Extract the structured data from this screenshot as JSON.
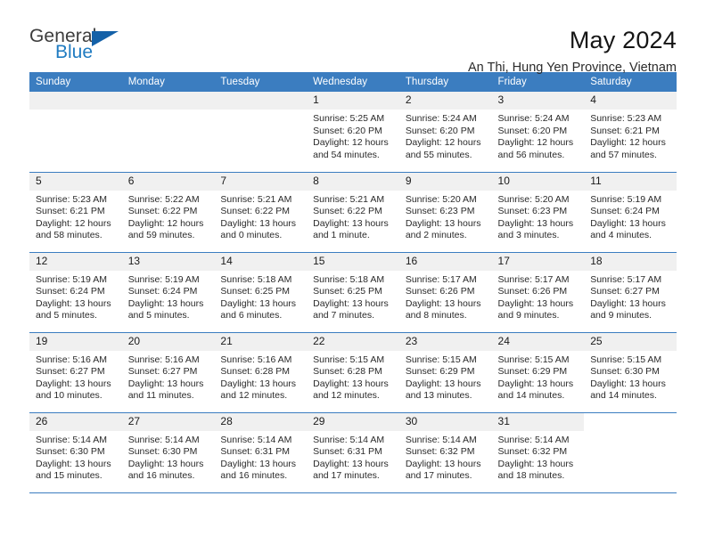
{
  "logo": {
    "word1": "General",
    "word2": "Blue",
    "accent_color": "#1461a8"
  },
  "header": {
    "title": "May 2024",
    "subtitle": "An Thi, Hung Yen Province, Vietnam"
  },
  "theme": {
    "header_bg": "#3b7dc0",
    "daynum_bg": "#f0f0f0",
    "text": "#2a2a2a"
  },
  "labels": {
    "sunrise": "Sunrise:",
    "sunset": "Sunset:",
    "daylight": "Daylight:"
  },
  "weekdays": [
    "Sunday",
    "Monday",
    "Tuesday",
    "Wednesday",
    "Thursday",
    "Friday",
    "Saturday"
  ],
  "weeks": [
    [
      {
        "day": "",
        "empty": true,
        "strip": true
      },
      {
        "day": "",
        "empty": true,
        "strip": true
      },
      {
        "day": "",
        "empty": true,
        "strip": true
      },
      {
        "day": "1",
        "sunrise": "Sunrise: 5:25 AM",
        "sunset": "Sunset: 6:20 PM",
        "daylight": "Daylight: 12 hours and 54 minutes."
      },
      {
        "day": "2",
        "sunrise": "Sunrise: 5:24 AM",
        "sunset": "Sunset: 6:20 PM",
        "daylight": "Daylight: 12 hours and 55 minutes."
      },
      {
        "day": "3",
        "sunrise": "Sunrise: 5:24 AM",
        "sunset": "Sunset: 6:20 PM",
        "daylight": "Daylight: 12 hours and 56 minutes."
      },
      {
        "day": "4",
        "sunrise": "Sunrise: 5:23 AM",
        "sunset": "Sunset: 6:21 PM",
        "daylight": "Daylight: 12 hours and 57 minutes."
      }
    ],
    [
      {
        "day": "5",
        "sunrise": "Sunrise: 5:23 AM",
        "sunset": "Sunset: 6:21 PM",
        "daylight": "Daylight: 12 hours and 58 minutes."
      },
      {
        "day": "6",
        "sunrise": "Sunrise: 5:22 AM",
        "sunset": "Sunset: 6:22 PM",
        "daylight": "Daylight: 12 hours and 59 minutes."
      },
      {
        "day": "7",
        "sunrise": "Sunrise: 5:21 AM",
        "sunset": "Sunset: 6:22 PM",
        "daylight": "Daylight: 13 hours and 0 minutes."
      },
      {
        "day": "8",
        "sunrise": "Sunrise: 5:21 AM",
        "sunset": "Sunset: 6:22 PM",
        "daylight": "Daylight: 13 hours and 1 minute."
      },
      {
        "day": "9",
        "sunrise": "Sunrise: 5:20 AM",
        "sunset": "Sunset: 6:23 PM",
        "daylight": "Daylight: 13 hours and 2 minutes."
      },
      {
        "day": "10",
        "sunrise": "Sunrise: 5:20 AM",
        "sunset": "Sunset: 6:23 PM",
        "daylight": "Daylight: 13 hours and 3 minutes."
      },
      {
        "day": "11",
        "sunrise": "Sunrise: 5:19 AM",
        "sunset": "Sunset: 6:24 PM",
        "daylight": "Daylight: 13 hours and 4 minutes."
      }
    ],
    [
      {
        "day": "12",
        "sunrise": "Sunrise: 5:19 AM",
        "sunset": "Sunset: 6:24 PM",
        "daylight": "Daylight: 13 hours and 5 minutes."
      },
      {
        "day": "13",
        "sunrise": "Sunrise: 5:19 AM",
        "sunset": "Sunset: 6:24 PM",
        "daylight": "Daylight: 13 hours and 5 minutes."
      },
      {
        "day": "14",
        "sunrise": "Sunrise: 5:18 AM",
        "sunset": "Sunset: 6:25 PM",
        "daylight": "Daylight: 13 hours and 6 minutes."
      },
      {
        "day": "15",
        "sunrise": "Sunrise: 5:18 AM",
        "sunset": "Sunset: 6:25 PM",
        "daylight": "Daylight: 13 hours and 7 minutes."
      },
      {
        "day": "16",
        "sunrise": "Sunrise: 5:17 AM",
        "sunset": "Sunset: 6:26 PM",
        "daylight": "Daylight: 13 hours and 8 minutes."
      },
      {
        "day": "17",
        "sunrise": "Sunrise: 5:17 AM",
        "sunset": "Sunset: 6:26 PM",
        "daylight": "Daylight: 13 hours and 9 minutes."
      },
      {
        "day": "18",
        "sunrise": "Sunrise: 5:17 AM",
        "sunset": "Sunset: 6:27 PM",
        "daylight": "Daylight: 13 hours and 9 minutes."
      }
    ],
    [
      {
        "day": "19",
        "sunrise": "Sunrise: 5:16 AM",
        "sunset": "Sunset: 6:27 PM",
        "daylight": "Daylight: 13 hours and 10 minutes."
      },
      {
        "day": "20",
        "sunrise": "Sunrise: 5:16 AM",
        "sunset": "Sunset: 6:27 PM",
        "daylight": "Daylight: 13 hours and 11 minutes."
      },
      {
        "day": "21",
        "sunrise": "Sunrise: 5:16 AM",
        "sunset": "Sunset: 6:28 PM",
        "daylight": "Daylight: 13 hours and 12 minutes."
      },
      {
        "day": "22",
        "sunrise": "Sunrise: 5:15 AM",
        "sunset": "Sunset: 6:28 PM",
        "daylight": "Daylight: 13 hours and 12 minutes."
      },
      {
        "day": "23",
        "sunrise": "Sunrise: 5:15 AM",
        "sunset": "Sunset: 6:29 PM",
        "daylight": "Daylight: 13 hours and 13 minutes."
      },
      {
        "day": "24",
        "sunrise": "Sunrise: 5:15 AM",
        "sunset": "Sunset: 6:29 PM",
        "daylight": "Daylight: 13 hours and 14 minutes."
      },
      {
        "day": "25",
        "sunrise": "Sunrise: 5:15 AM",
        "sunset": "Sunset: 6:30 PM",
        "daylight": "Daylight: 13 hours and 14 minutes."
      }
    ],
    [
      {
        "day": "26",
        "sunrise": "Sunrise: 5:14 AM",
        "sunset": "Sunset: 6:30 PM",
        "daylight": "Daylight: 13 hours and 15 minutes."
      },
      {
        "day": "27",
        "sunrise": "Sunrise: 5:14 AM",
        "sunset": "Sunset: 6:30 PM",
        "daylight": "Daylight: 13 hours and 16 minutes."
      },
      {
        "day": "28",
        "sunrise": "Sunrise: 5:14 AM",
        "sunset": "Sunset: 6:31 PM",
        "daylight": "Daylight: 13 hours and 16 minutes."
      },
      {
        "day": "29",
        "sunrise": "Sunrise: 5:14 AM",
        "sunset": "Sunset: 6:31 PM",
        "daylight": "Daylight: 13 hours and 17 minutes."
      },
      {
        "day": "30",
        "sunrise": "Sunrise: 5:14 AM",
        "sunset": "Sunset: 6:32 PM",
        "daylight": "Daylight: 13 hours and 17 minutes."
      },
      {
        "day": "31",
        "sunrise": "Sunrise: 5:14 AM",
        "sunset": "Sunset: 6:32 PM",
        "daylight": "Daylight: 13 hours and 18 minutes."
      },
      {
        "day": "",
        "empty": true,
        "strip": false
      }
    ]
  ]
}
